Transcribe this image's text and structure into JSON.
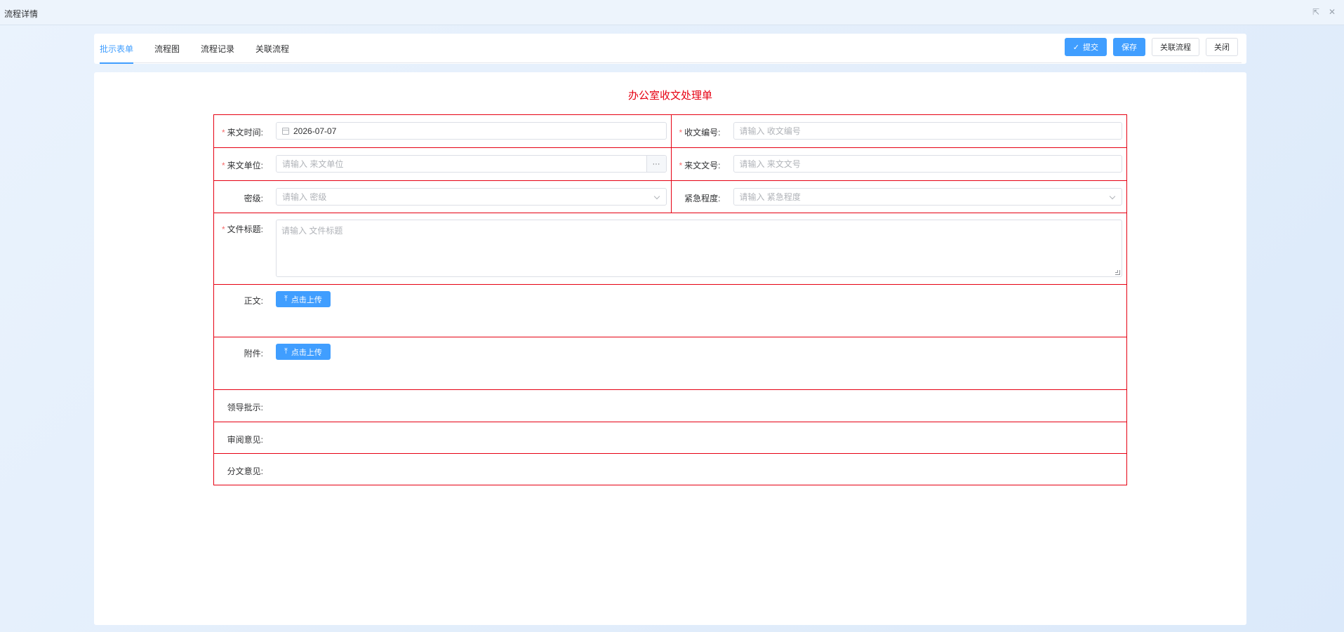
{
  "window": {
    "title": "流程详情",
    "restore_glyph": "⇱",
    "close_glyph": "✕"
  },
  "tabs": [
    {
      "label": "批示表单",
      "active": true
    },
    {
      "label": "流程图",
      "active": false
    },
    {
      "label": "流程记录",
      "active": false
    },
    {
      "label": "关联流程",
      "active": false
    }
  ],
  "actions": {
    "submit_label": "提交",
    "save_label": "保存",
    "link_flow_label": "关联流程",
    "close_label": "关闭"
  },
  "form": {
    "title": "办公室收文处理单",
    "fields": {
      "receive_time": {
        "label": "来文时间:",
        "required": true,
        "value": "2026-07-07"
      },
      "receipt_no": {
        "label": "收文编号:",
        "required": true,
        "placeholder": "请输入 收文编号"
      },
      "sender_unit": {
        "label": "来文单位:",
        "required": true,
        "placeholder": "请输入 来文单位",
        "append": "···"
      },
      "doc_no": {
        "label": "来文文号:",
        "required": true,
        "placeholder": "请输入 来文文号"
      },
      "secret_level": {
        "label": "密级:",
        "required": false,
        "placeholder": "请输入 密级"
      },
      "urgency": {
        "label": "紧急程度:",
        "required": false,
        "placeholder": "请输入 紧急程度"
      },
      "doc_title": {
        "label": "文件标题:",
        "required": true,
        "placeholder": "请输入 文件标题"
      },
      "body": {
        "label": "正文:",
        "upload_label": "点击上传"
      },
      "attachment": {
        "label": "附件:",
        "upload_label": "点击上传"
      },
      "leader_instruction": {
        "label": "领导批示:"
      },
      "review_opinion": {
        "label": "审阅意见:"
      },
      "distribution_opinion": {
        "label": "分文意见:"
      }
    },
    "required_mark": "*"
  },
  "colors": {
    "accent": "#409eff",
    "form_border": "#e60012",
    "form_title": "#e60012",
    "required": "#f56c6c"
  }
}
